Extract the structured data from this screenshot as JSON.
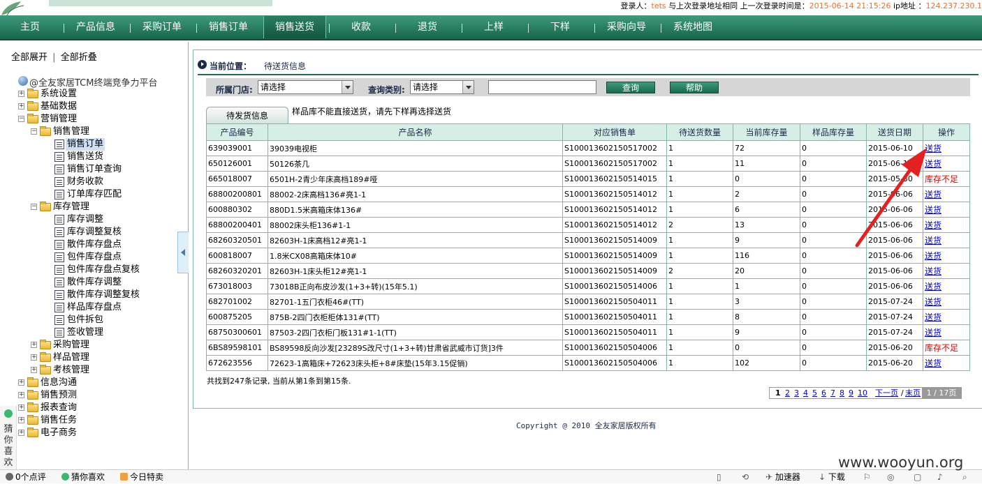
{
  "header": {
    "login_label": "登录人：",
    "login_user": "tets",
    "login_text": " 与上次登录地址相同  上一次登录时间是：",
    "last_login_time": "2015-06-14 21:15:26",
    "ip_label": "  ip地址 ：",
    "ip_value": "124.237.230.1"
  },
  "nav": {
    "items": [
      "主页",
      "产品信息",
      "采购订单",
      "销售订单",
      "销售送货",
      "收款",
      "退货",
      "上样",
      "下样",
      "采购向导",
      "系统地图"
    ],
    "active_index": 4
  },
  "sidebar": {
    "expand_all": "全部展开",
    "divider": "|",
    "collapse_all": "全部折叠",
    "root": "@全友家居TCM终端竞争力平台",
    "tree": {
      "system_settings": "系统设置",
      "base_data": "基础数据",
      "marketing": "营销管理",
      "sales_mgmt": "销售管理",
      "sales_order": "销售订单",
      "sales_delivery": "销售送货",
      "sales_order_query": "销售订单查询",
      "finance_receipt": "财务收款",
      "order_stock_match": "订单库存匹配",
      "stock_mgmt": "库存管理",
      "stock_adjust": "库存调整",
      "stock_adjust_review": "库存调整复核",
      "loose_stock_count": "散件库存盘点",
      "pack_stock_count": "包件库存盘点",
      "pack_stock_count_review": "包件库存盘点复核",
      "loose_stock_adjust": "散件库存调整",
      "loose_stock_adjust_review": "散件库存调整复核",
      "sample_stock_count": "样品库存盘点",
      "pack_split": "包件拆包",
      "sign_mgmt": "签收管理",
      "purchase_mgmt": "采购管理",
      "sample_mgmt": "样品管理",
      "assessment_mgmt": "考核管理",
      "info_comm": "信息沟通",
      "sales_forecast": "销售预测",
      "report_query": "报表查询",
      "sales_task": "销售任务",
      "ecommerce": "电子商务"
    }
  },
  "guess_widget": {
    "text": "猜你喜欢"
  },
  "content": {
    "location_label": "当前位置：",
    "location_value": "待送货信息",
    "filter": {
      "store_label": "所属门店:",
      "store_value": "请选择",
      "type_label": "查询类别:",
      "type_value": "请选择",
      "query_value": "",
      "query_button": "查询",
      "help_button": "帮助"
    },
    "tab_label": "待发货信息",
    "tab_note": "样品库不能直接送货，请先下样再选择送货",
    "columns": [
      "产品编号",
      "产品名称",
      "对应销售单",
      "待送货数量",
      "当前库存量",
      "样品库存量",
      "送货日期",
      "操作"
    ],
    "rows": [
      [
        "639039001",
        "39039电视柜",
        "S100013602150517002",
        "1",
        "72",
        "0",
        "2015-06-10",
        "送货"
      ],
      [
        "650126001",
        "50126茶几",
        "S100013602150517002",
        "1",
        "11",
        "0",
        "2015-06-10",
        "送货"
      ],
      [
        "665018007",
        "6501H-2青少年床高档189#哑",
        "S100013602150514015",
        "1",
        "0",
        "0",
        "2015-05-30",
        "库存不足"
      ],
      [
        "68800200801",
        "88002-2床高档136#亮1-1",
        "S100013602150514012",
        "1",
        "2",
        "0",
        "2015-06-06",
        "送货"
      ],
      [
        "600880302",
        "880D1.5米高箱床体136#",
        "S100013602150514012",
        "1",
        "6",
        "0",
        "2015-06-06",
        "送货"
      ],
      [
        "68800200401",
        "88002床头柜136#1-1",
        "S100013602150514012",
        "2",
        "13",
        "0",
        "2015-06-06",
        "送货"
      ],
      [
        "68260320501",
        "82603H-1床高档12#亮1-1",
        "S100013602150514009",
        "1",
        "9",
        "0",
        "2015-06-06",
        "送货"
      ],
      [
        "600818007",
        "1.8米CX08高箱床体10#",
        "S100013602150514009",
        "1",
        "116",
        "0",
        "2015-06-06",
        "送货"
      ],
      [
        "68260320201",
        "82603H-1床头柜12#亮1-1",
        "S100013602150514009",
        "2",
        "20",
        "0",
        "2015-06-06",
        "送货"
      ],
      [
        "673018003",
        "73018B正向布皮沙发(1+3+转)(15年5.1)",
        "S100013602150514006",
        "1",
        "1",
        "0",
        "2015-06-06",
        "送货"
      ],
      [
        "682701002",
        "82701-1五门衣柜46#(TT)",
        "S100013602150504011",
        "1",
        "3",
        "0",
        "2015-07-24",
        "送货"
      ],
      [
        "600875205",
        "875B-2四门衣柜柜体131#(TT)",
        "S100013602150504011",
        "1",
        "8",
        "0",
        "2015-07-24",
        "送货"
      ],
      [
        "68750300601",
        "87503-2四门衣柜门板131#1-1(TT)",
        "S100013602150504011",
        "1",
        "9",
        "0",
        "2015-07-24",
        "送货"
      ],
      [
        "6BS89598101",
        "BS89598反向沙发[23289S改尺寸(1+3+转)甘肃省武威市订货]3件",
        "S100013602150504006",
        "1",
        "0",
        "0",
        "2015-06-20",
        "库存不足"
      ],
      [
        "672623556",
        "72623-1高箱床+72623床头柜+8#床垫(15年3.15促销)",
        "S100013602150504006",
        "1",
        "102",
        "0",
        "2015-06-20",
        "送货"
      ]
    ],
    "summary": "共找到247条记录, 当前从第1条到第15条.",
    "pager": {
      "current": "1",
      "pages": [
        "2",
        "3",
        "4",
        "5",
        "6",
        "7",
        "8",
        "9",
        "10"
      ],
      "next": "下一页",
      "slash": "/",
      "last": "末页",
      "info": "1 / 17页"
    },
    "copyright": "Copyright @ 2010 全友家居版权所有"
  },
  "statusbar": {
    "comments": "0个点评",
    "guess": "猜你喜欢",
    "today": "今日特卖",
    "accelerator": "加速器",
    "download": "下载"
  },
  "watermark": "www.wooyun.org",
  "colors": {
    "nav_green": "#1a6a4f",
    "table_header_bg": "#d6efe6",
    "highlight_orange": "#e5722d",
    "warning_red": "#dd0000",
    "annotation_arrow": "#e52020"
  }
}
